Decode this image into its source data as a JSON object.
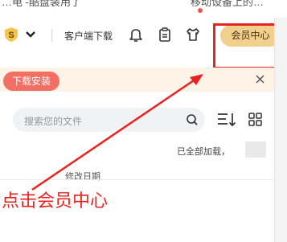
{
  "top_strip": {
    "left_text": "…电 -酷盘装用了",
    "right_text": "移动设备上的…"
  },
  "toolbar": {
    "vip_badge_letter": "S",
    "download_client_label": "客户端下载",
    "member_center_label": "会员中心"
  },
  "banner": {
    "install_label": "下载安装",
    "close_symbol": "✕"
  },
  "search": {
    "placeholder": "搜索您的文件"
  },
  "file_list": {
    "loaded_status": "已全部加载，",
    "column_modified": "修改日期"
  },
  "annotation": {
    "text": "点击会员中心",
    "color": "#e8231f"
  },
  "colors": {
    "member_button": "#f1cf8c",
    "install_button": "#f26f63",
    "banner_bg": "#fdf3e7",
    "notification_dot": "#f2504b"
  }
}
